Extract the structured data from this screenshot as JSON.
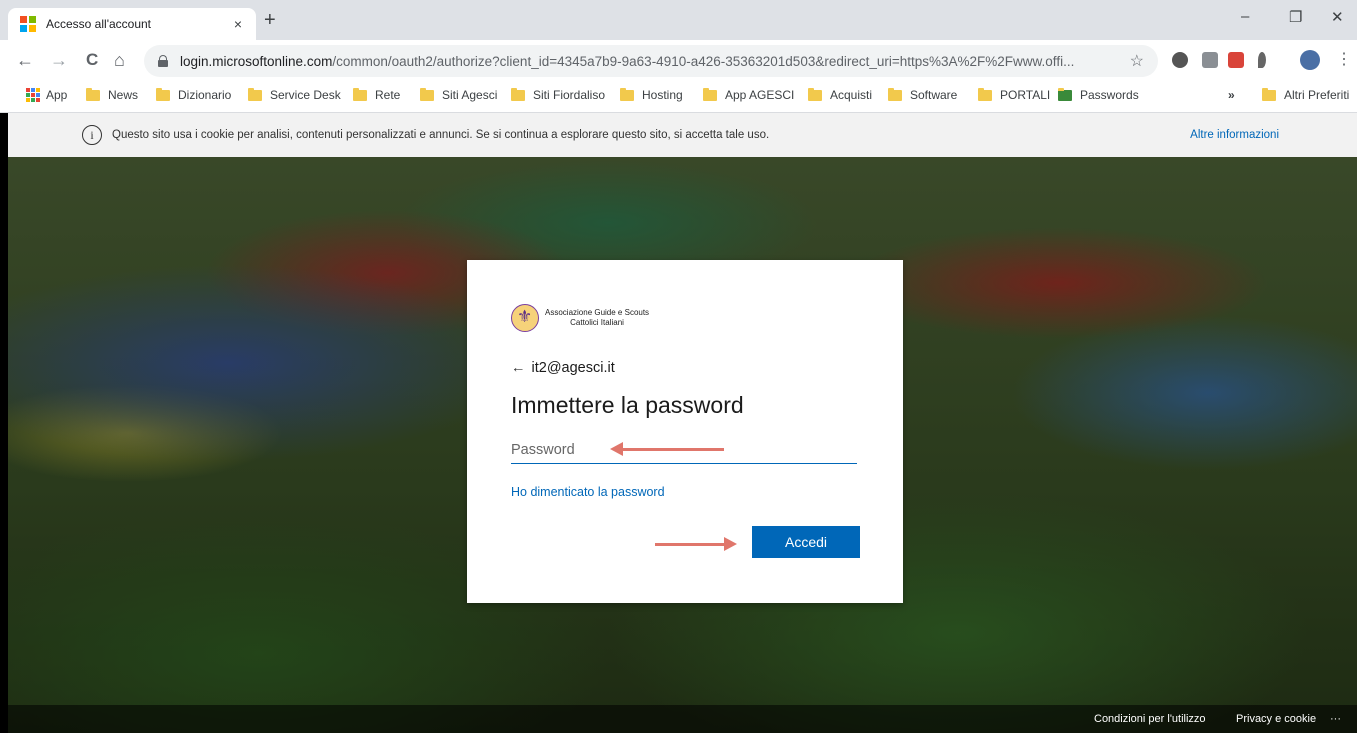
{
  "browser": {
    "tab_title": "Accesso all'account",
    "tab_close": "×",
    "new_tab": "+",
    "window_controls": {
      "minimize": "–",
      "restore": "❐",
      "close": "✕"
    },
    "nav": {
      "back": "←",
      "forward": "→",
      "reload": "C",
      "home": "⌂"
    },
    "url_host": "login.microsoftonline.com",
    "url_path": "/common/oauth2/authorize?client_id=4345a7b9-9a63-4910-a426-35363201d503&redirect_uri=https%3A%2F%2Fwww.offi...",
    "bookmark_star": "☆",
    "menu_dots": "⋮",
    "bookmarks": [
      "App",
      "News",
      "Dizionario",
      "Service Desk",
      "Rete",
      "Siti Agesci",
      "Siti Fiordaliso",
      "Hosting",
      "App AGESCI",
      "Acquisti",
      "Software",
      "PORTALI",
      "Passwords"
    ],
    "bookmarks_overflow": "»",
    "other_bookmarks": "Altri Preferiti",
    "ms_colors": [
      "#f25022",
      "#7fba00",
      "#00a4ef",
      "#ffb900"
    ]
  },
  "cookie_bar": {
    "icon": "info-icon",
    "text": "Questo sito usa i cookie per analisi, contenuti personalizzati e annunci. Se si continua a esplorare questo sito, si accetta tale uso.",
    "link": "Altre informazioni"
  },
  "login": {
    "org_name_line1": "Associazione Guide e Scouts",
    "org_name_line2": "Cattolici Italiani",
    "back_arrow": "←",
    "account": "it2@agesci.it",
    "heading": "Immettere la password",
    "password_placeholder": "Password",
    "forgot_link": "Ho dimenticato la password",
    "signin_button": "Accedi",
    "accent_color": "#0067b8"
  },
  "footer": {
    "terms": "Condizioni per l'utilizzo",
    "privacy": "Privacy e cookie",
    "more": "···"
  }
}
